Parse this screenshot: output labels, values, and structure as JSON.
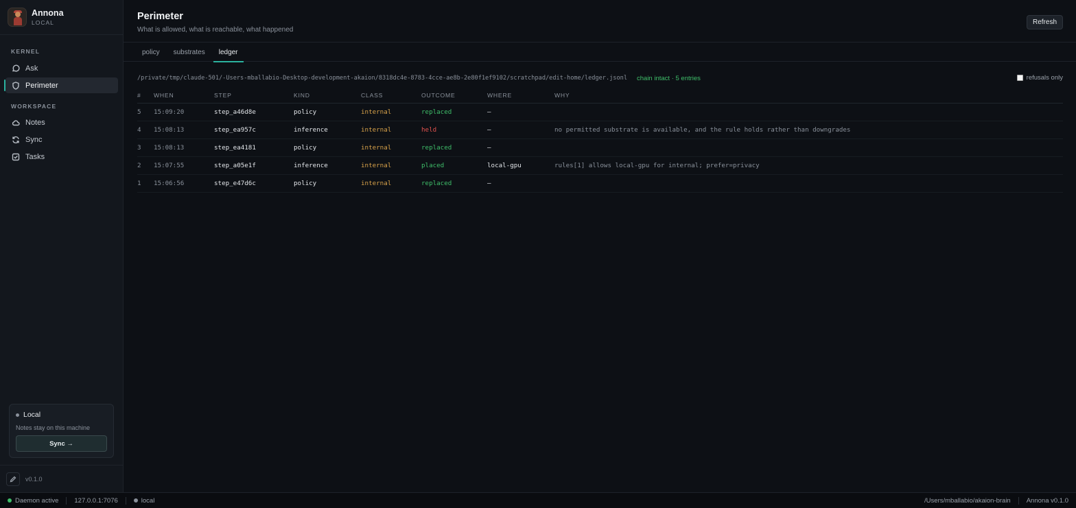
{
  "brand": {
    "name": "Annona",
    "sub": "LOCAL"
  },
  "sidebar": {
    "sections": [
      {
        "label": "KERNEL",
        "items": [
          {
            "label": "Ask",
            "icon": "chat-bubble-icon"
          },
          {
            "label": "Perimeter",
            "icon": "shield-icon",
            "active": true
          }
        ]
      },
      {
        "label": "WORKSPACE",
        "items": [
          {
            "label": "Notes",
            "icon": "cloud-icon"
          },
          {
            "label": "Sync",
            "icon": "sync-icon"
          },
          {
            "label": "Tasks",
            "icon": "checkbox-icon"
          }
        ]
      }
    ],
    "local_card": {
      "title": "Local",
      "desc": "Notes stay on this machine",
      "button": "Sync →"
    },
    "version": "v0.1.0"
  },
  "header": {
    "title": "Perimeter",
    "subtitle": "What is allowed, what is reachable, what happened",
    "refresh": "Refresh"
  },
  "tabs": [
    {
      "label": "policy"
    },
    {
      "label": "substrates"
    },
    {
      "label": "ledger",
      "active": true
    }
  ],
  "ledger": {
    "path": "/private/tmp/claude-501/-Users-mballabio-Desktop-development-akaion/8318dc4e-8783-4cce-ae8b-2e80f1ef9102/scratchpad/edit-home/ledger.jsonl",
    "chain_status": "chain intact · 5 entries",
    "refusals_label": "refusals only",
    "refusals_checked": false,
    "columns": [
      "#",
      "WHEN",
      "STEP",
      "KIND",
      "CLASS",
      "OUTCOME",
      "WHERE",
      "WHY"
    ],
    "rows": [
      {
        "num": "5",
        "when": "15:09:20",
        "step": "step_a46d8e",
        "kind": "policy",
        "class": "internal",
        "outcome": "replaced",
        "where": "—",
        "why": ""
      },
      {
        "num": "4",
        "when": "15:08:13",
        "step": "step_ea957c",
        "kind": "inference",
        "class": "internal",
        "outcome": "held",
        "where": "—",
        "why": "no permitted substrate is available, and the rule holds rather than downgrades"
      },
      {
        "num": "3",
        "when": "15:08:13",
        "step": "step_ea4181",
        "kind": "policy",
        "class": "internal",
        "outcome": "replaced",
        "where": "—",
        "why": ""
      },
      {
        "num": "2",
        "when": "15:07:55",
        "step": "step_a05e1f",
        "kind": "inference",
        "class": "internal",
        "outcome": "placed",
        "where": "local-gpu",
        "why": "rules[1] allows local-gpu for internal; prefer=privacy"
      },
      {
        "num": "1",
        "when": "15:06:56",
        "step": "step_e47d6c",
        "kind": "policy",
        "class": "internal",
        "outcome": "replaced",
        "where": "—",
        "why": ""
      }
    ]
  },
  "outcome_colors": {
    "replaced": "#3fbf6a",
    "placed": "#3fbf6a",
    "held": "#e0524e"
  },
  "statusbar": {
    "daemon": "Daemon active",
    "address": "127.0.0.1:7076",
    "mode": "local",
    "path": "/Users/mballabio/akaion-brain",
    "app_version": "Annona v0.1.0"
  }
}
